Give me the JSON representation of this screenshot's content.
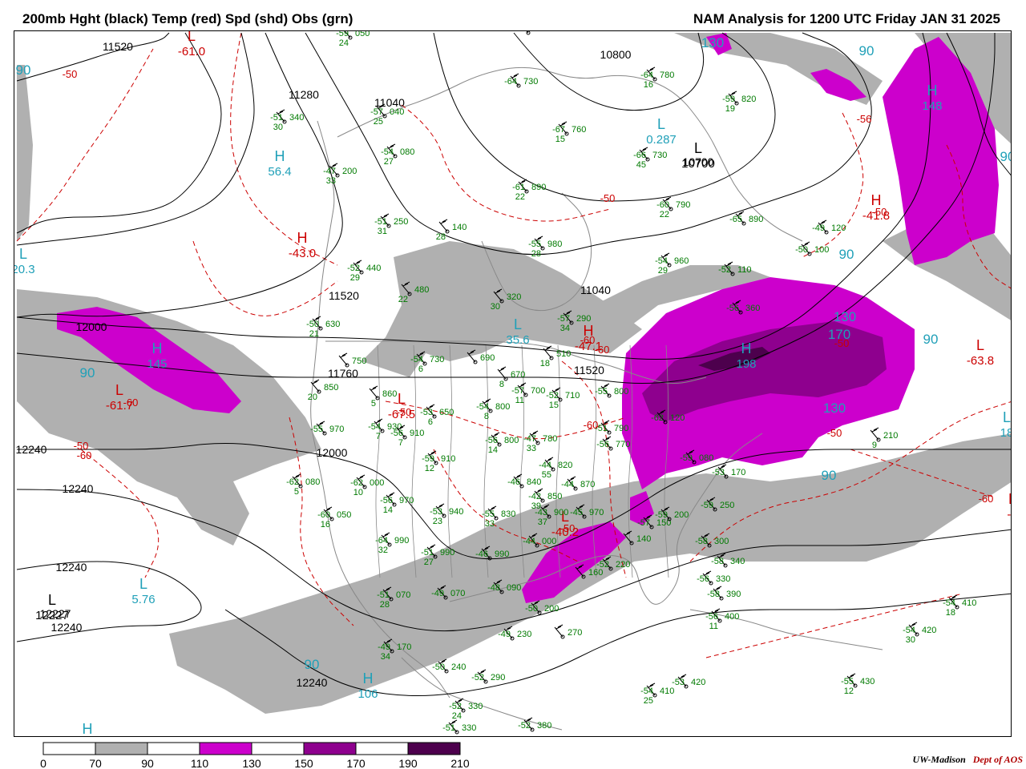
{
  "header": {
    "left_title": "200mb Hght (black) Temp (red) Spd (shd) Obs (grn)",
    "right_title": "NAM Analysis for 1200 UTC Friday  JAN 31 2025"
  },
  "colors": {
    "height_contour": "#000000",
    "temperature_contour": "#cc0000",
    "observations": "#007a00",
    "speed_label": "#20a0b8",
    "boundaries": "#888888",
    "speed_70_90": "#b0b0b0",
    "speed_110_130": "#cc00cc",
    "speed_150_170": "#8e008e",
    "speed_190_210": "#4d004d"
  },
  "legend": {
    "ticks": [
      "0",
      "70",
      "90",
      "110",
      "130",
      "150",
      "170",
      "190",
      "210"
    ],
    "fills": [
      "#ffffff",
      "#b0b0b0",
      "#ffffff",
      "#cc00cc",
      "#ffffff",
      "#8e008e",
      "#ffffff",
      "#4d004d"
    ]
  },
  "height_labels": [
    "11520",
    "11280",
    "11040",
    "10800",
    "10700",
    "11040",
    "11520",
    "12000",
    "11760",
    "11520",
    "12000",
    "12240",
    "12240",
    "12240",
    "12227",
    "12240",
    "12240"
  ],
  "temperature_labels": [
    "-61.0",
    "-50",
    "-60",
    "-60",
    "-43.0",
    "-50",
    "-61.7",
    "-60",
    "-60",
    "-67.5",
    "-50",
    "-47.1",
    "-50",
    "-56",
    "-40.2",
    "-50",
    "-41.8",
    "-50",
    "-50",
    "-60",
    "-63.8",
    "-58",
    "-60",
    "-50",
    "-5"
  ],
  "center_markers": [
    {
      "letter": "L",
      "value": "-61.0",
      "kind": "temperature"
    },
    {
      "letter": "H",
      "value": "56.4",
      "kind": "speed"
    },
    {
      "letter": "L",
      "value": "20.3",
      "kind": "speed"
    },
    {
      "letter": "H",
      "value": "-43.0",
      "kind": "temperature"
    },
    {
      "letter": "H",
      "value": "145",
      "kind": "speed"
    },
    {
      "letter": "L",
      "value": "-61.7",
      "kind": "temperature"
    },
    {
      "letter": "L",
      "value": "0.287",
      "kind": "speed"
    },
    {
      "letter": "L",
      "value": "10700",
      "kind": "height"
    },
    {
      "letter": "L",
      "value": "35.6",
      "kind": "speed"
    },
    {
      "letter": "H",
      "value": "-47.1",
      "kind": "temperature"
    },
    {
      "letter": "L",
      "value": "-67.5",
      "kind": "temperature"
    },
    {
      "letter": "L",
      "value": "-40.2",
      "kind": "temperature"
    },
    {
      "letter": "L",
      "value": "-5",
      "kind": "temperature"
    },
    {
      "letter": "L",
      "value": "5.76",
      "kind": "speed"
    },
    {
      "letter": "L",
      "value": "12227",
      "kind": "height"
    },
    {
      "letter": "H",
      "value": "106",
      "kind": "speed"
    },
    {
      "letter": "H",
      "value": "198",
      "kind": "speed"
    },
    {
      "letter": "H",
      "value": "-41.8",
      "kind": "temperature"
    },
    {
      "letter": "H",
      "value": "148",
      "kind": "speed"
    },
    {
      "letter": "L",
      "value": "-63.8",
      "kind": "temperature"
    },
    {
      "letter": "L",
      "value": "18",
      "kind": "speed"
    },
    {
      "letter": "H",
      "value": "",
      "kind": "speed"
    }
  ],
  "speed_labels": [
    "90",
    "90",
    "90",
    "90",
    "90",
    "90",
    "90",
    "130",
    "130",
    "130",
    "170",
    "90"
  ],
  "observations": [
    {
      "temp": "-59",
      "height": "050",
      "dew": "24"
    },
    {
      "temp": "-66",
      "height": "140",
      "dew": ""
    },
    {
      "temp": "-64",
      "height": "780",
      "dew": "16"
    },
    {
      "temp": "-64",
      "height": "730",
      "dew": ""
    },
    {
      "temp": "-59",
      "height": "820",
      "dew": "19"
    },
    {
      "temp": "-51",
      "height": "340",
      "dew": "30"
    },
    {
      "temp": "-57",
      "height": "040",
      "dew": "25"
    },
    {
      "temp": "-54",
      "height": "080",
      "dew": "27"
    },
    {
      "temp": "-47",
      "height": "200",
      "dew": "33"
    },
    {
      "temp": "-66",
      "height": "730",
      "dew": "45"
    },
    {
      "temp": "-67",
      "height": "760",
      "dew": "15"
    },
    {
      "temp": "-61",
      "height": "890",
      "dew": "22"
    },
    {
      "temp": "-60",
      "height": "790",
      "dew": "22"
    },
    {
      "temp": "-65",
      "height": "890",
      "dew": ""
    },
    {
      "temp": "-49",
      "height": "120",
      "dew": ""
    },
    {
      "temp": "-51",
      "height": "250",
      "dew": "31"
    },
    {
      "temp": "",
      "height": "140",
      "dew": "28"
    },
    {
      "temp": "-55",
      "height": "980",
      "dew": "28"
    },
    {
      "temp": "-54",
      "height": "960",
      "dew": "29"
    },
    {
      "temp": "-50",
      "height": "100",
      "dew": ""
    },
    {
      "temp": "-52",
      "height": "110",
      "dew": ""
    },
    {
      "temp": "-52",
      "height": "440",
      "dew": "29"
    },
    {
      "temp": "",
      "height": "480",
      "dew": "22"
    },
    {
      "temp": "",
      "height": "320",
      "dew": "30"
    },
    {
      "temp": "-57",
      "height": "290",
      "dew": "34"
    },
    {
      "temp": "-56",
      "height": "360",
      "dew": ""
    },
    {
      "temp": "-50",
      "height": "630",
      "dew": "21"
    },
    {
      "temp": "",
      "height": "750",
      "dew": ""
    },
    {
      "temp": "",
      "height": "510",
      "dew": "18"
    },
    {
      "temp": "-54",
      "height": "730",
      "dew": "6"
    },
    {
      "temp": "",
      "height": "690",
      "dew": ""
    },
    {
      "temp": "",
      "height": "850",
      "dew": "20"
    },
    {
      "temp": "",
      "height": "860",
      "dew": "5"
    },
    {
      "temp": "",
      "height": "670",
      "dew": "8"
    },
    {
      "temp": "-57",
      "height": "700",
      "dew": "11"
    },
    {
      "temp": "-52",
      "height": "710",
      "dew": "15"
    },
    {
      "temp": "-55",
      "height": "800",
      "dew": ""
    },
    {
      "temp": "-53",
      "height": "650",
      "dew": "6"
    },
    {
      "temp": "-54",
      "height": "800",
      "dew": "8"
    },
    {
      "temp": "-51",
      "height": "790",
      "dew": ""
    },
    {
      "temp": "-55",
      "height": "970",
      "dew": ""
    },
    {
      "temp": "-54",
      "height": "930",
      "dew": "7"
    },
    {
      "temp": "-56",
      "height": "910",
      "dew": "7"
    },
    {
      "temp": "-56",
      "height": "800",
      "dew": "14"
    },
    {
      "temp": "-47",
      "height": "780",
      "dew": "33"
    },
    {
      "temp": "-56",
      "height": "770",
      "dew": ""
    },
    {
      "temp": "-62",
      "height": "120",
      "dew": ""
    },
    {
      "temp": "-59",
      "height": "080",
      "dew": ""
    },
    {
      "temp": "-53",
      "height": "170",
      "dew": ""
    },
    {
      "temp": "-62",
      "height": "080",
      "dew": "5"
    },
    {
      "temp": "-62",
      "height": "000",
      "dew": "10"
    },
    {
      "temp": "-59",
      "height": "910",
      "dew": "12"
    },
    {
      "temp": "-44",
      "height": "820",
      "dew": "55"
    },
    {
      "temp": "-46",
      "height": "840",
      "dew": ""
    },
    {
      "temp": "-44",
      "height": "870",
      "dew": ""
    },
    {
      "temp": "-42",
      "height": "850",
      "dew": "39"
    },
    {
      "temp": "-56",
      "height": "970",
      "dew": "14"
    },
    {
      "temp": "-53",
      "height": "940",
      "dew": "23"
    },
    {
      "temp": "-55",
      "height": "830",
      "dew": "33"
    },
    {
      "temp": "-43",
      "height": "900",
      "dew": "37"
    },
    {
      "temp": "-45",
      "height": "970",
      "dew": ""
    },
    {
      "temp": "-57",
      "height": "150",
      "dew": ""
    },
    {
      "temp": "-59",
      "height": "200",
      "dew": ""
    },
    {
      "temp": "-59",
      "height": "250",
      "dew": ""
    },
    {
      "temp": "-60",
      "height": "050",
      "dew": "16"
    },
    {
      "temp": "-64",
      "height": "990",
      "dew": "32"
    },
    {
      "temp": "-51",
      "height": "990",
      "dew": "27"
    },
    {
      "temp": "-46",
      "height": "990",
      "dew": ""
    },
    {
      "temp": "-44",
      "height": "000",
      "dew": ""
    },
    {
      "temp": "-52",
      "height": "220",
      "dew": ""
    },
    {
      "temp": "",
      "height": "140",
      "dew": ""
    },
    {
      "temp": "-58",
      "height": "300",
      "dew": ""
    },
    {
      "temp": "-58",
      "height": "340",
      "dew": ""
    },
    {
      "temp": "-56",
      "height": "330",
      "dew": ""
    },
    {
      "temp": "-58",
      "height": "390",
      "dew": ""
    },
    {
      "temp": "-56",
      "height": "400",
      "dew": "11"
    },
    {
      "temp": "-51",
      "height": "070",
      "dew": "28"
    },
    {
      "temp": "-49",
      "height": "070",
      "dew": ""
    },
    {
      "temp": "-48",
      "height": "090",
      "dew": ""
    },
    {
      "temp": "-50",
      "height": "200",
      "dew": ""
    },
    {
      "temp": "",
      "height": "160",
      "dew": ""
    },
    {
      "temp": "-49",
      "height": "230",
      "dew": ""
    },
    {
      "temp": "",
      "height": "270",
      "dew": ""
    },
    {
      "temp": "-49",
      "height": "170",
      "dew": "34"
    },
    {
      "temp": "-50",
      "height": "240",
      "dew": ""
    },
    {
      "temp": "-52",
      "height": "290",
      "dew": ""
    },
    {
      "temp": "-52",
      "height": "330",
      "dew": "24"
    },
    {
      "temp": "-51",
      "height": "330",
      "dew": ""
    },
    {
      "temp": "-52",
      "height": "380",
      "dew": ""
    },
    {
      "temp": "-54",
      "height": "410",
      "dew": "25"
    },
    {
      "temp": "-53",
      "height": "420",
      "dew": ""
    },
    {
      "temp": "-55",
      "height": "430",
      "dew": "12"
    },
    {
      "temp": "-54",
      "height": "420",
      "dew": "30"
    },
    {
      "temp": "-54",
      "height": "410",
      "dew": "18"
    },
    {
      "temp": "",
      "height": "210",
      "dew": "9"
    }
  ],
  "credit": {
    "org": "UW-Madison",
    "dept": "Dept of AOS"
  }
}
